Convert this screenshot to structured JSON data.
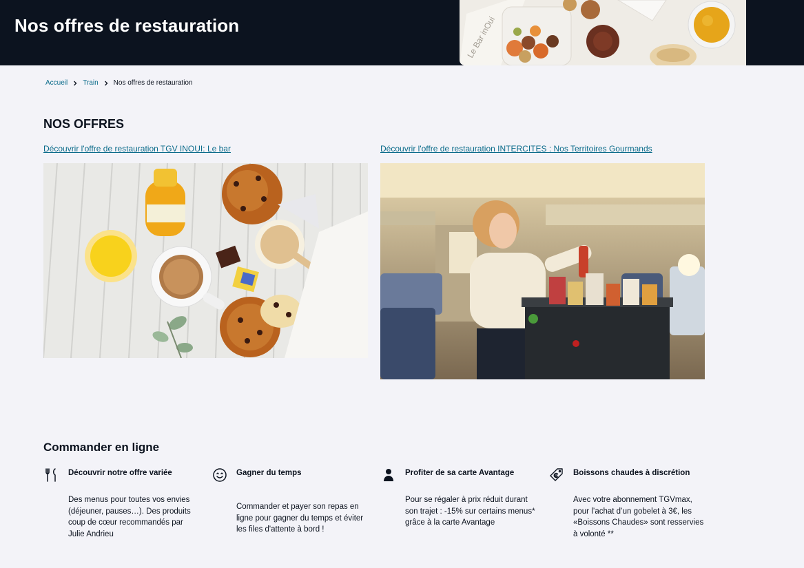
{
  "header": {
    "title": "Nos offres de restauration",
    "image_alt": "Le Bar inOui food tray"
  },
  "breadcrumb": {
    "items": [
      "Accueil",
      "Train"
    ],
    "current": "Nos offres de restauration"
  },
  "offers": {
    "title": "NOS OFFRES",
    "items": [
      {
        "link": " Découvrir l'offre de restauration TGV INOUI: Le bar",
        "image": "breakfast-photo"
      },
      {
        "link": "Découvrir l'offre de restauration INTERCITES : Nos Territoires Gourmands",
        "image": "trolley-photo"
      }
    ]
  },
  "order": {
    "title": "Commander en ligne",
    "features": [
      {
        "icon": "cutlery-icon",
        "heading": "Découvrir notre offre variée",
        "desc": "Des menus pour toutes vos envies (déjeuner, pauses…). Des produits coup de cœur recommandés par Julie Andrieu"
      },
      {
        "icon": "smiley-icon",
        "heading": "Gagner du temps",
        "desc": "Commander et payer son repas en ligne pour gagner du temps et éviter les files d'attente à bord !"
      },
      {
        "icon": "person-icon",
        "heading": "Profiter de sa carte Avantage",
        "desc": "Pour se régaler à prix réduit durant son trajet : -15% sur certains menus* grâce à la carte Avantage"
      },
      {
        "icon": "euro-tag-icon",
        "heading": "Boissons chaudes à discrétion",
        "desc": "Avec votre abonnement TGVmax, pour l’achat d’un gobelet à 3€, les «Boissons Chaudes» sont resservies à volonté **"
      }
    ]
  },
  "colors": {
    "header_bg": "#0c131f",
    "page_bg": "#f3f3f8",
    "link": "#0a6b8a",
    "text": "#0c131f"
  }
}
